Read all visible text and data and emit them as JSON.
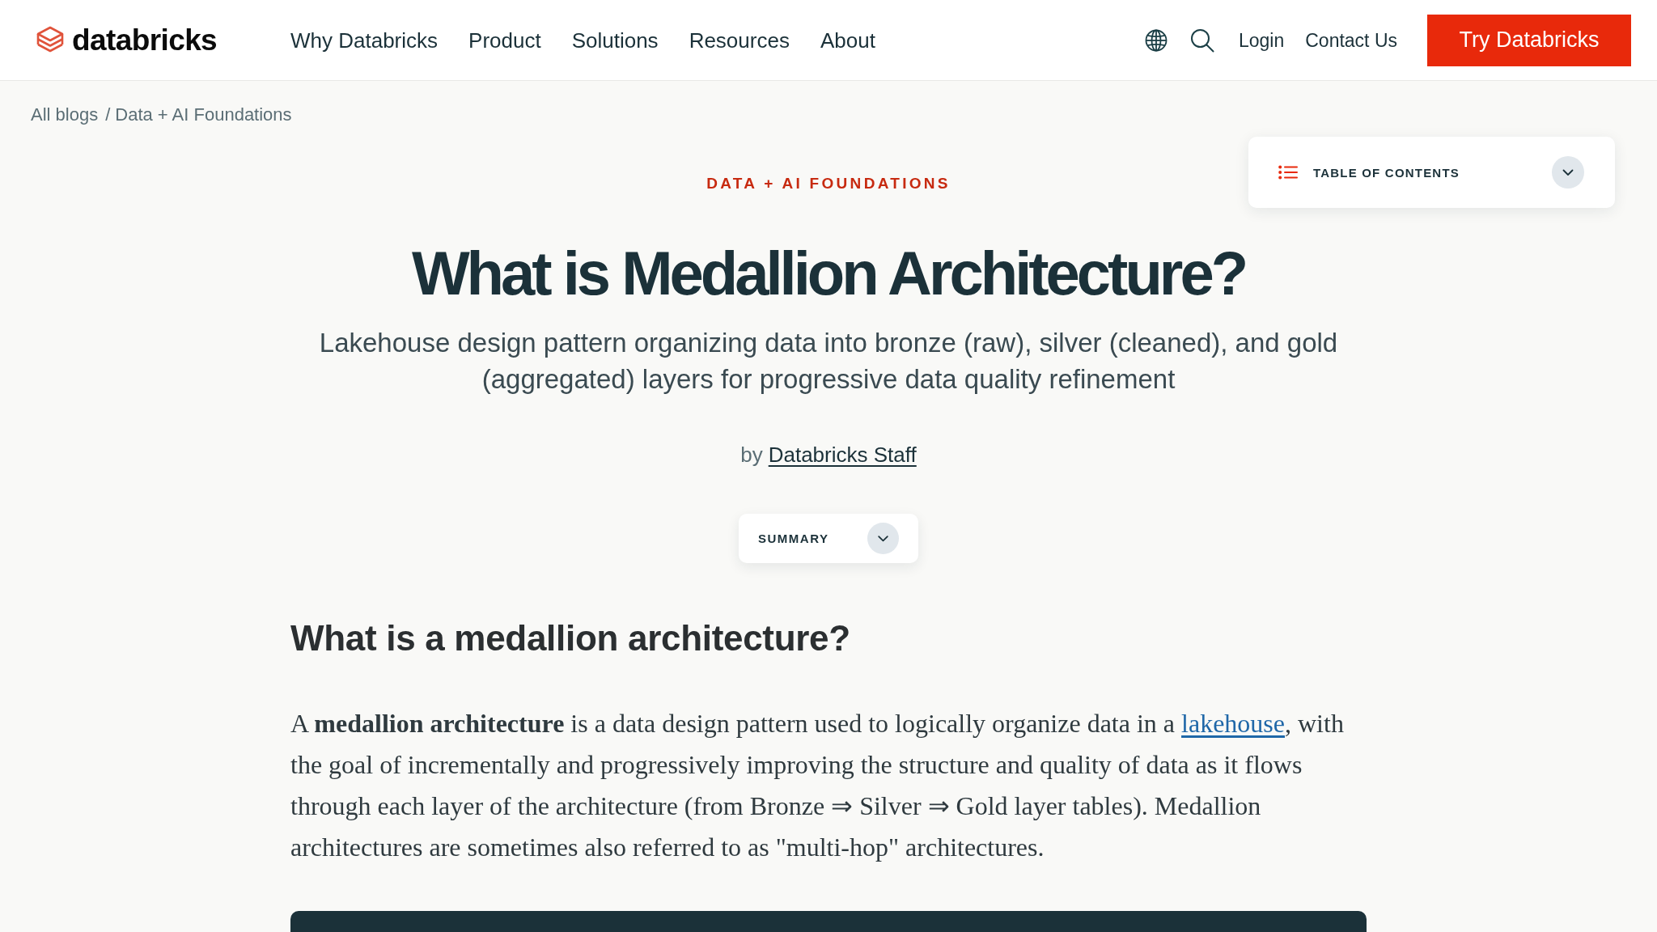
{
  "header": {
    "logo_text": "databricks",
    "nav": [
      "Why Databricks",
      "Product",
      "Solutions",
      "Resources",
      "About"
    ],
    "links": [
      "Login",
      "Contact Us"
    ],
    "cta_button": "Try Databricks"
  },
  "breadcrumb": {
    "items": [
      "All blogs",
      "Data + AI Foundations"
    ],
    "separator": "/"
  },
  "table_of_contents": {
    "label": "TABLE OF CONTENTS",
    "expanded": false
  },
  "article": {
    "category": "DATA + AI FOUNDATIONS",
    "title": "What is Medallion Architecture?",
    "subtitle": "Lakehouse design pattern organizing data into bronze (raw), silver (cleaned), and gold (aggregated) layers for progressive data quality refinement",
    "byline": {
      "prefix": "by",
      "author": "Databricks Staff"
    },
    "summary": {
      "label": "SUMMARY",
      "expanded": false
    },
    "section_heading": "What is a medallion architecture?",
    "paragraph": {
      "text_before_link": "A **medallion architecture** is a data design pattern used to logically organize data in a ",
      "link": "lakehouse",
      "text_after_link": ", with the goal of incrementally and progressively improving the structure and quality of data as it flows through each layer of the architecture (from Bronze ⇒ Silver ⇒ Gold layer tables). Medallion architectures are sometimes also referred to as \"multi-hop\" architectures."
    }
  }
}
